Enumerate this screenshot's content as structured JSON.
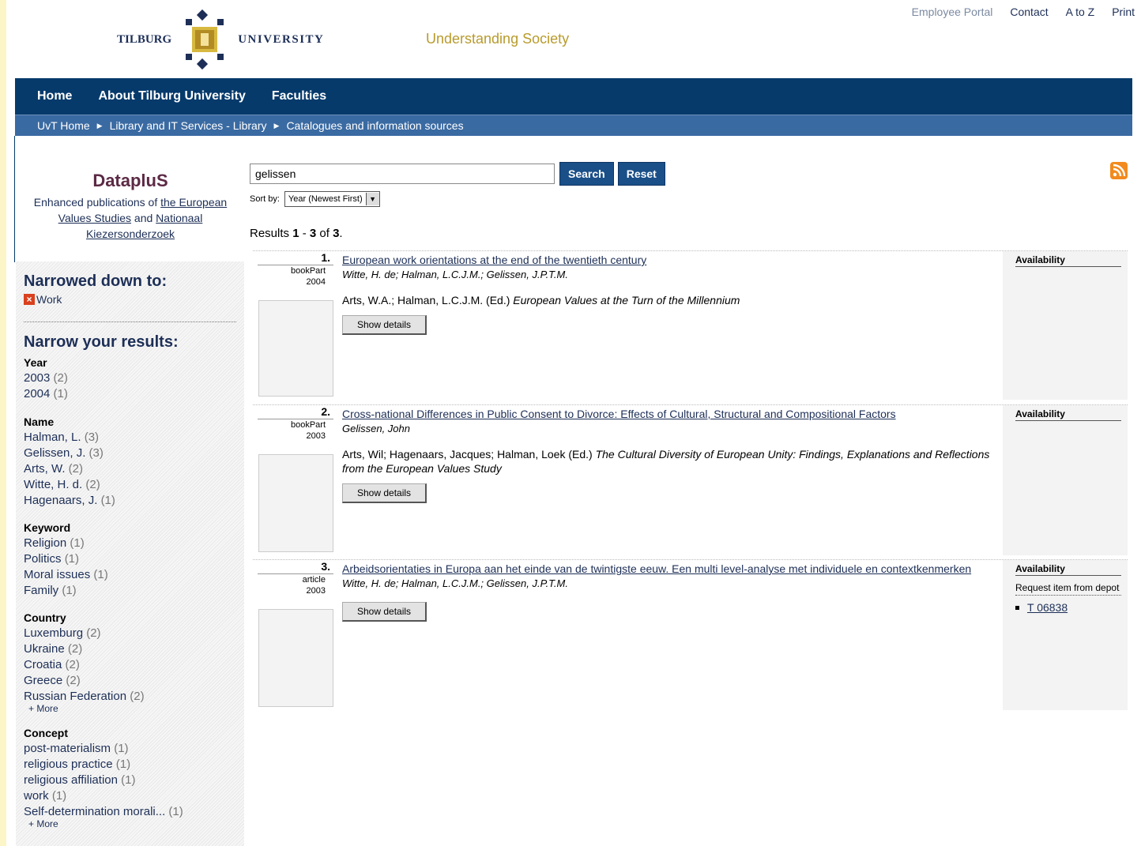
{
  "header": {
    "logo_left": "Tilburg",
    "logo_right": "University",
    "tagline": "Understanding Society",
    "top_links": [
      "Employee Portal",
      "Contact",
      "A to Z",
      "Print"
    ]
  },
  "nav": {
    "items": [
      "Home",
      "About Tilburg University",
      "Faculties"
    ]
  },
  "breadcrumb": [
    "UvT Home",
    "Library and IT Services - Library",
    "Catalogues and information sources"
  ],
  "brand": {
    "name": "DatapluS",
    "desc_prefix": "Enhanced publications of ",
    "link1": "the European Values Studies",
    "and": " and ",
    "link2": "Nationaal Kiezersonderzoek"
  },
  "sidebar": {
    "narrowed_title": "Narrowed down to:",
    "narrowed_item": "Work",
    "narrow_title": "Narrow your results:",
    "facets": [
      {
        "title": "Year",
        "items": [
          {
            "l": "2003",
            "c": "(2)"
          },
          {
            "l": "2004",
            "c": "(1)"
          }
        ]
      },
      {
        "title": "Name",
        "items": [
          {
            "l": "Halman, L.",
            "c": "(3)"
          },
          {
            "l": "Gelissen, J.",
            "c": "(3)"
          },
          {
            "l": "Arts, W.",
            "c": "(2)"
          },
          {
            "l": "Witte, H. d.",
            "c": "(2)"
          },
          {
            "l": "Hagenaars, J.",
            "c": "(1)"
          }
        ]
      },
      {
        "title": "Keyword",
        "items": [
          {
            "l": "Religion",
            "c": "(1)"
          },
          {
            "l": "Politics",
            "c": "(1)"
          },
          {
            "l": "Moral issues",
            "c": "(1)"
          },
          {
            "l": "Family",
            "c": "(1)"
          }
        ]
      },
      {
        "title": "Country",
        "items": [
          {
            "l": "Luxemburg",
            "c": "(2)"
          },
          {
            "l": "Ukraine",
            "c": "(2)"
          },
          {
            "l": "Croatia",
            "c": "(2)"
          },
          {
            "l": "Greece",
            "c": "(2)"
          },
          {
            "l": "Russian Federation",
            "c": "(2)"
          }
        ],
        "more": "+ More"
      },
      {
        "title": "Concept",
        "items": [
          {
            "l": "post-materialism",
            "c": "(1)"
          },
          {
            "l": "religious practice",
            "c": "(1)"
          },
          {
            "l": "religious affiliation",
            "c": "(1)"
          },
          {
            "l": "work",
            "c": "(1)"
          },
          {
            "l": "Self-determination morali...",
            "c": "(1)"
          }
        ],
        "more": "+ More"
      }
    ]
  },
  "search": {
    "value": "gelissen",
    "search_label": "Search",
    "reset_label": "Reset",
    "sort_label": "Sort by:",
    "sort_value": "Year (Newest First)"
  },
  "results": {
    "count_prefix": "Results ",
    "from": "1",
    "dash": " - ",
    "to": "3",
    "of": " of ",
    "total": "3",
    "end": "."
  },
  "records": [
    {
      "num": "1.",
      "type": "bookPart",
      "year": "2004",
      "title": "European work orientations at the end of the twentieth century",
      "authors": "Witte, H. de; Halman, L.C.J.M.; Gelissen, J.P.T.M.",
      "source_plain": "Arts, W.A.; Halman, L.C.J.M. (Ed.) ",
      "source_italic": "European Values at the Turn of the Millennium",
      "show_details": "Show details",
      "availability": "Availability"
    },
    {
      "num": "2.",
      "type": "bookPart",
      "year": "2003",
      "title": "Cross-national Differences in Public Consent to Divorce: Effects of Cultural, Structural and Compositional Factors",
      "authors": "Gelissen, John",
      "source_plain": "Arts, Wil; Hagenaars, Jacques; Halman, Loek (Ed.) ",
      "source_italic": "The Cultural Diversity of European Unity: Findings, Explanations and Reflections from the European Values Study",
      "show_details": "Show details",
      "availability": "Availability"
    },
    {
      "num": "3.",
      "type": "article",
      "year": "2003",
      "title": "Arbeidsorientaties in Europa aan het einde van de twintigste eeuw. Een multi level-analyse met individuele en contextkenmerken",
      "authors": "Witte, H. de; Halman, L.C.J.M.; Gelissen, J.P.T.M.",
      "show_details": "Show details",
      "availability": "Availability",
      "request": "Request item from depot",
      "location": "T 06838"
    }
  ]
}
